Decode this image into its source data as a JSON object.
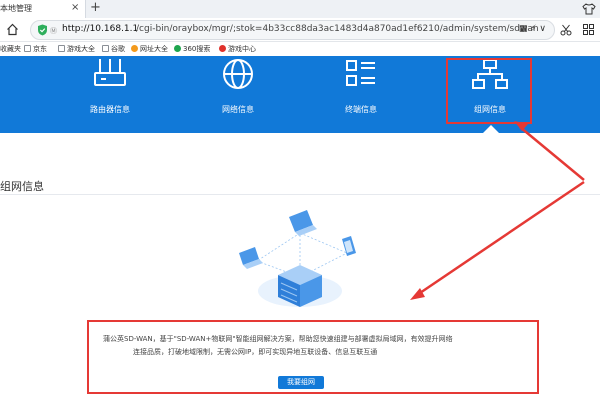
{
  "browser": {
    "tab_title": "本地管理",
    "tab_close": "×",
    "new_tab": "+",
    "url_host": "http://10.168.1.1",
    "url_path": "/cgi-bin/oraybox/mgr/;stok=4b33cc88da3ac1483d4a870ad1ef6210/admin/system/sdwan",
    "site_flag": "Ⓜ",
    "url_icons": "▦ ⚡ ∨",
    "icons": [
      "home-icon",
      "shield-icon",
      "scissor-icon",
      "grid-icon",
      "shirt-icon"
    ],
    "bookmarks": [
      {
        "label": "收藏夹",
        "icon": "none"
      },
      {
        "label": "京东",
        "icon": "folder"
      },
      {
        "label": "游戏大全",
        "icon": "folder"
      },
      {
        "label": "谷歌",
        "icon": "folder"
      },
      {
        "label": "网址大全",
        "icon": "orange"
      },
      {
        "label": "360搜索",
        "icon": "green"
      },
      {
        "label": "游戏中心",
        "icon": "red"
      }
    ]
  },
  "nav": {
    "items": [
      {
        "label": "路由器信息",
        "icon": "router-icon"
      },
      {
        "label": "网络信息",
        "icon": "globe-icon"
      },
      {
        "label": "终端信息",
        "icon": "list-icon"
      },
      {
        "label": "组网信息",
        "icon": "network-icon",
        "active": true
      }
    ]
  },
  "section": {
    "title": "组网信息"
  },
  "description": {
    "line1": "蒲公英SD-WAN，基于\"SD-WAN+物联网\"智能组网解决方案，帮助您快速组建与部署虚拟局域网，有效提升网络",
    "line2": "连接品质，打破地域限制，无需公网IP，即可实现异地互联设备、信息互联互通",
    "button": "我要组网"
  },
  "colors": {
    "nav_blue": "#1179d8",
    "annotation_red": "#e53935"
  }
}
